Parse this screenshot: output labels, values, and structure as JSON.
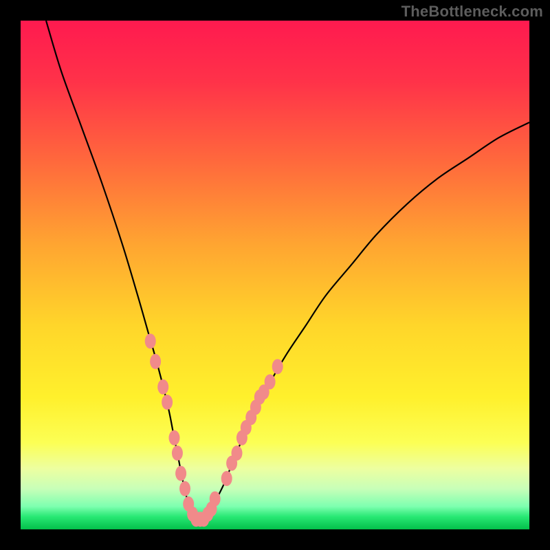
{
  "attribution": "TheBottleneck.com",
  "colors": {
    "frame": "#000000",
    "curve": "#000000",
    "marker_fill": "#f18a8a",
    "marker_stroke": "#e26a6a",
    "gradient_stops": [
      {
        "offset": 0.0,
        "color": "#ff1a4f"
      },
      {
        "offset": 0.12,
        "color": "#ff3249"
      },
      {
        "offset": 0.28,
        "color": "#ff6a3c"
      },
      {
        "offset": 0.44,
        "color": "#ffa531"
      },
      {
        "offset": 0.6,
        "color": "#ffd62a"
      },
      {
        "offset": 0.74,
        "color": "#fff02c"
      },
      {
        "offset": 0.83,
        "color": "#fcff55"
      },
      {
        "offset": 0.88,
        "color": "#edffa0"
      },
      {
        "offset": 0.92,
        "color": "#c8ffb8"
      },
      {
        "offset": 0.955,
        "color": "#7dffb0"
      },
      {
        "offset": 0.975,
        "color": "#28e874"
      },
      {
        "offset": 1.0,
        "color": "#03c04a"
      }
    ]
  },
  "chart_data": {
    "type": "line",
    "title": "",
    "xlabel": "",
    "ylabel": "",
    "xlim": [
      0,
      100
    ],
    "ylim": [
      0,
      100
    ],
    "series": [
      {
        "name": "bottleneck-curve",
        "x": [
          5,
          8,
          12,
          16,
          20,
          23,
          25,
          27,
          29,
          30,
          31,
          32,
          33,
          34,
          35,
          36,
          37,
          38,
          40,
          42,
          45,
          48,
          52,
          56,
          60,
          65,
          70,
          76,
          82,
          88,
          94,
          100
        ],
        "y": [
          100,
          90,
          79,
          68,
          56,
          46,
          39,
          32,
          24,
          19,
          14,
          9,
          5,
          3,
          2,
          2,
          3,
          5,
          9,
          14,
          21,
          27,
          34,
          40,
          46,
          52,
          58,
          64,
          69,
          73,
          77,
          80
        ]
      }
    ],
    "markers": {
      "name": "highlighted-points",
      "points": [
        {
          "x": 25.5,
          "y": 37
        },
        {
          "x": 26.5,
          "y": 33
        },
        {
          "x": 28.0,
          "y": 28
        },
        {
          "x": 28.8,
          "y": 25
        },
        {
          "x": 30.2,
          "y": 18
        },
        {
          "x": 30.8,
          "y": 15
        },
        {
          "x": 31.5,
          "y": 11
        },
        {
          "x": 32.3,
          "y": 8
        },
        {
          "x": 33.0,
          "y": 5
        },
        {
          "x": 33.8,
          "y": 3
        },
        {
          "x": 34.5,
          "y": 2
        },
        {
          "x": 35.3,
          "y": 2
        },
        {
          "x": 36.0,
          "y": 2
        },
        {
          "x": 36.8,
          "y": 3
        },
        {
          "x": 37.5,
          "y": 4
        },
        {
          "x": 38.2,
          "y": 6
        },
        {
          "x": 40.5,
          "y": 10
        },
        {
          "x": 41.5,
          "y": 13
        },
        {
          "x": 42.5,
          "y": 15
        },
        {
          "x": 43.5,
          "y": 18
        },
        {
          "x": 44.3,
          "y": 20
        },
        {
          "x": 45.3,
          "y": 22
        },
        {
          "x": 46.2,
          "y": 24
        },
        {
          "x": 47.0,
          "y": 26
        },
        {
          "x": 47.8,
          "y": 27
        },
        {
          "x": 49.0,
          "y": 29
        },
        {
          "x": 50.5,
          "y": 32
        }
      ]
    }
  }
}
